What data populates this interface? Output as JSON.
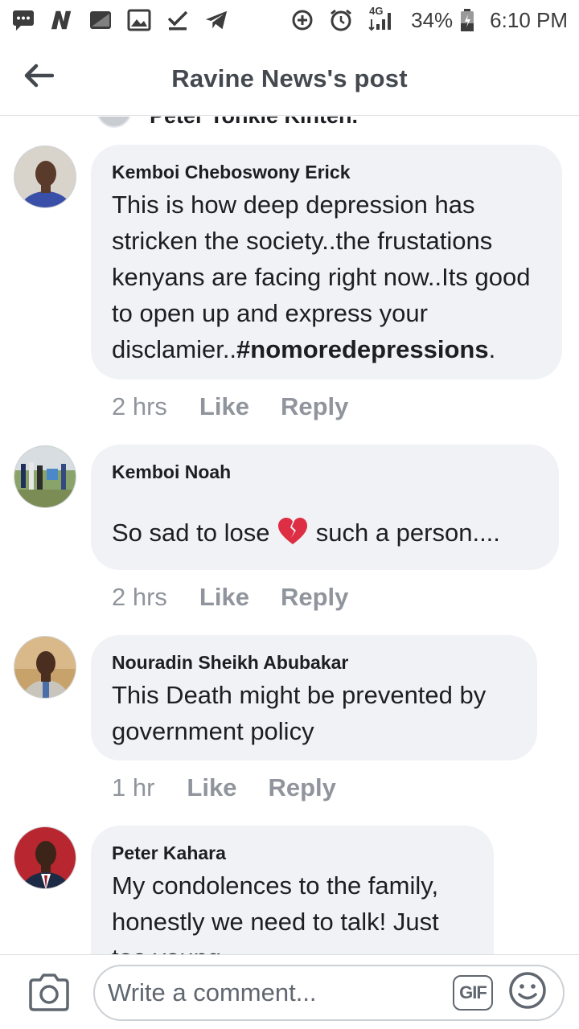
{
  "status_bar": {
    "battery": "34%",
    "time": "6:10 PM",
    "network": "4G",
    "icons_left": [
      "messages-icon",
      "news-icon",
      "photos-icon",
      "gallery-icon",
      "download-done-icon",
      "telegram-icon"
    ],
    "icons_right": [
      "data-saver-icon",
      "alarm-icon",
      "signal-icon",
      "battery-icon"
    ]
  },
  "header": {
    "title": "Ravine News's post",
    "back_icon": "back-arrow-icon"
  },
  "feed": {
    "clipped_previous_name": "Peter Tonkie Kinten.",
    "comments": [
      {
        "author": "Kemboi Cheboswony Erick",
        "text": "This is how deep depression has stricken the society..the frustations kenyans are facing right now..Its good to open up and express your disclamier..",
        "hashtag": "#nomoredepressions",
        "text_end": ".",
        "time": "2 hrs",
        "like": "Like",
        "reply": "Reply"
      },
      {
        "author": "Kemboi Noah",
        "text_before": "So sad to lose",
        "emoji": "💔",
        "text_after": "such a person....",
        "time": "2 hrs",
        "like": "Like",
        "reply": "Reply"
      },
      {
        "author": "Nouradin Sheikh Abubakar",
        "text": "This Death might be prevented by government policy",
        "time": "1 hr",
        "like": "Like",
        "reply": "Reply"
      },
      {
        "author": "Peter Kahara",
        "text": "My condolences to the family, honestly we need to talk! Just too young"
      }
    ]
  },
  "composer": {
    "placeholder": "Write a comment...",
    "gif_label": "GIF",
    "camera_icon": "camera-icon",
    "emoji_icon": "emoji-icon"
  },
  "colors": {
    "bubble": "#f0f2f5",
    "meta_text": "#90949c",
    "header_text": "#444950"
  }
}
